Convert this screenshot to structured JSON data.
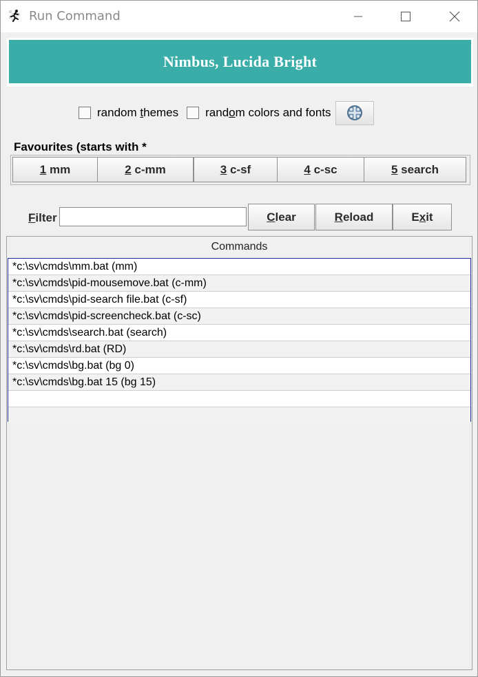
{
  "window": {
    "title": "Run Command"
  },
  "banner": {
    "text": "Nimbus, Lucida Bright",
    "color": "#3aada8"
  },
  "options": {
    "random_themes": {
      "pre": "random ",
      "ul": "t",
      "post": "hemes"
    },
    "random_colors": {
      "pre": "rand",
      "ul": "o",
      "post": "m colors and fonts"
    },
    "theme_icon": "palette-icon"
  },
  "favourites": {
    "title": "Favourites (starts with *",
    "buttons": [
      {
        "key": "1",
        "text": " mm"
      },
      {
        "key": "2",
        "text": " c-mm"
      },
      {
        "key": "3",
        "text": " c-sf"
      },
      {
        "key": "4",
        "text": " c-sc"
      },
      {
        "key": "5",
        "text": " search"
      }
    ]
  },
  "filter": {
    "label_ul": "F",
    "label_rest": "ilter",
    "value": "",
    "clear": {
      "ul": "C",
      "rest": "lear"
    },
    "reload": {
      "ul": "R",
      "rest": "eload"
    },
    "exit": {
      "pre": "E",
      "ul": "x",
      "post": "it"
    }
  },
  "commands": {
    "header": "Commands",
    "rows": [
      "*c:\\sv\\cmds\\mm.bat (mm)",
      "*c:\\sv\\cmds\\pid-mousemove.bat (c-mm)",
      "*c:\\sv\\cmds\\pid-search file.bat (c-sf)",
      "*c:\\sv\\cmds\\pid-screencheck.bat (c-sc)",
      "*c:\\sv\\cmds\\search.bat (search)",
      "*c:\\sv\\cmds\\rd.bat (RD)",
      "*c:\\sv\\cmds\\bg.bat (bg 0)",
      "*c:\\sv\\cmds\\bg.bat 15 (bg 15)",
      "",
      ""
    ]
  }
}
